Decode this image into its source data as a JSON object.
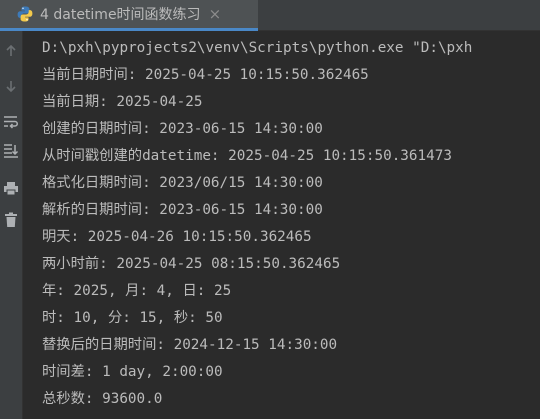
{
  "tab": {
    "icon": "python-icon",
    "label": "4 datetime时间函数练习",
    "close": "×"
  },
  "gutter": {
    "buttons": [
      "rerun-up-arrow-icon",
      "down-arrow-icon",
      "soft-wrap-icon",
      "scroll-to-end-icon",
      "print-icon",
      "trash-icon"
    ]
  },
  "colors": {
    "background": "#2b2b2b",
    "panel": "#3c3f41",
    "text": "#bbbbbb",
    "tab_underline": "#4a88c7"
  },
  "console": {
    "lines": [
      "D:\\pxh\\pyprojects2\\venv\\Scripts\\python.exe \"D:\\pxh",
      "当前日期时间: 2025-04-25 10:15:50.362465",
      "当前日期: 2025-04-25",
      "创建的日期时间: 2023-06-15 14:30:00",
      "从时间戳创建的datetime: 2025-04-25 10:15:50.361473",
      "格式化日期时间: 2023/06/15 14:30:00",
      "解析的日期时间: 2023-06-15 14:30:00",
      "明天: 2025-04-26 10:15:50.362465",
      "两小时前: 2025-04-25 08:15:50.362465",
      "年: 2025, 月: 4, 日: 25",
      "时: 10, 分: 15, 秒: 50",
      "替换后的日期时间: 2024-12-15 14:30:00",
      "时间差: 1 day, 2:00:00",
      "总秒数: 93600.0"
    ]
  }
}
